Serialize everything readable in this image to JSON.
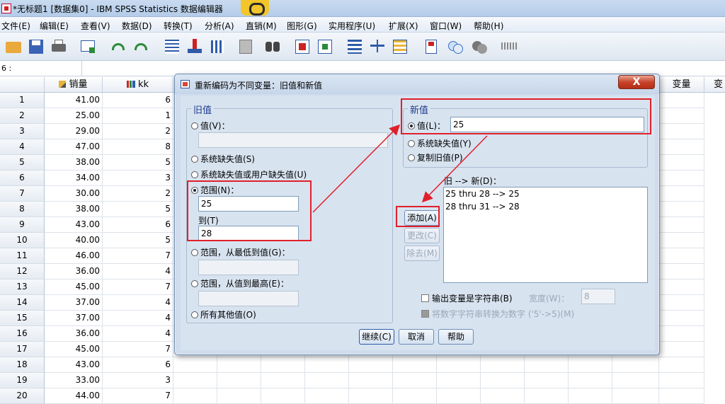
{
  "window": {
    "title": "*无标题1 [数据集0] - IBM SPSS Statistics 数据编辑器"
  },
  "menu": [
    "文件(E)",
    "编辑(E)",
    "查看(V)",
    "数据(D)",
    "转换(T)",
    "分析(A)",
    "直销(M)",
    "图形(G)",
    "实用程序(U)",
    "扩展(X)",
    "窗口(W)",
    "帮助(H)"
  ],
  "refbar": {
    "cell": "6 :"
  },
  "grid": {
    "col1": "销量",
    "col2": "kk",
    "right_cols": [
      "变量",
      "变"
    ],
    "rows": [
      [
        "1",
        "41.00",
        "6"
      ],
      [
        "2",
        "25.00",
        "1"
      ],
      [
        "3",
        "29.00",
        "2"
      ],
      [
        "4",
        "47.00",
        "8"
      ],
      [
        "5",
        "38.00",
        "5"
      ],
      [
        "6",
        "34.00",
        "3"
      ],
      [
        "7",
        "30.00",
        "2"
      ],
      [
        "8",
        "38.00",
        "5"
      ],
      [
        "9",
        "43.00",
        "6"
      ],
      [
        "10",
        "40.00",
        "5"
      ],
      [
        "11",
        "46.00",
        "7"
      ],
      [
        "12",
        "36.00",
        "4"
      ],
      [
        "13",
        "45.00",
        "7"
      ],
      [
        "14",
        "37.00",
        "4"
      ],
      [
        "15",
        "37.00",
        "4"
      ],
      [
        "16",
        "36.00",
        "4"
      ],
      [
        "17",
        "45.00",
        "7"
      ],
      [
        "18",
        "43.00",
        "6"
      ],
      [
        "19",
        "33.00",
        "3"
      ],
      [
        "20",
        "44.00",
        "7"
      ]
    ]
  },
  "dialog": {
    "title": "重新编码为不同变量：旧值和新值",
    "close": "X",
    "old": {
      "legend": "旧值",
      "value_label": "值(V)：",
      "sysmis_label": "系统缺失值(S)",
      "sysusermis_label": "系统缺失值或用户缺失值(U)",
      "range_label": "范围(N)：",
      "range_from": "25",
      "to_label": "到(T)",
      "range_to": "28",
      "lowest_label": "范围，从最低到值(G)：",
      "highest_label": "范围，从值到最高(E)：",
      "else_label": "所有其他值(O)"
    },
    "new": {
      "legend": "新值",
      "value_label": "值(L)：",
      "value": "25",
      "sysmis_label": "系统缺失值(Y)",
      "copy_label": "复制旧值(P)"
    },
    "mapping": {
      "label": "旧 --> 新(D)：",
      "items": [
        "25 thru 28 --> 25",
        "28 thru 31 --> 28"
      ]
    },
    "buttons": {
      "add": "添加(A)",
      "change": "更改(C)",
      "remove": "除去(M)"
    },
    "options": {
      "string_output": "输出变量是字符串(B)",
      "width_label": "宽度(W)：",
      "width_value": "8",
      "convert_numeric": "将数字字符串转换为数字 ('5'->5)(M)"
    },
    "footer": {
      "continue": "继续(C)",
      "cancel": "取消",
      "help": "帮助"
    }
  }
}
